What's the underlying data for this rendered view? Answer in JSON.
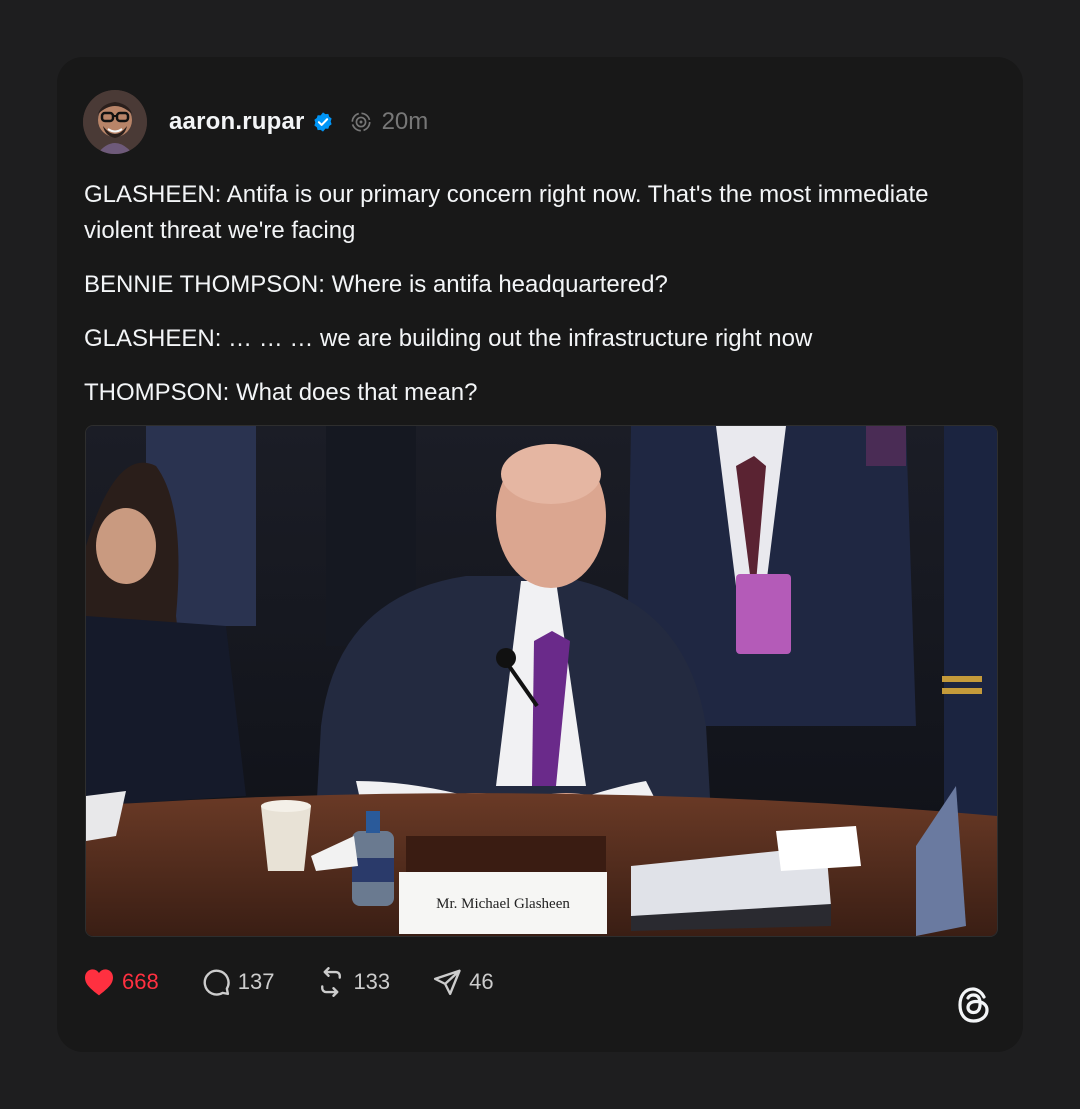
{
  "post": {
    "author": {
      "username": "aaron.rupar",
      "avatar_icon": "avatar",
      "verified_icon": "verified-badge-icon"
    },
    "timestamp": "20m",
    "paragraphs": [
      "GLASHEEN: Antifa is our primary concern right now. That's the most immediate violent threat we're facing",
      "BENNIE THOMPSON: Where is antifa headquartered?",
      "GLASHEEN: … … … we are building out the infrastructure right now",
      "THOMPSON: What does that mean?"
    ],
    "media": {
      "nameplate_text": "Mr. Michael Glasheen"
    },
    "actions": {
      "likes": "668",
      "replies": "137",
      "reposts": "133",
      "shares": "46"
    }
  },
  "colors": {
    "background": "#1e1e1f",
    "card": "#181818",
    "text": "#f3f5f7",
    "muted": "#777777",
    "like": "#ff3040",
    "verified": "#0095f6"
  }
}
